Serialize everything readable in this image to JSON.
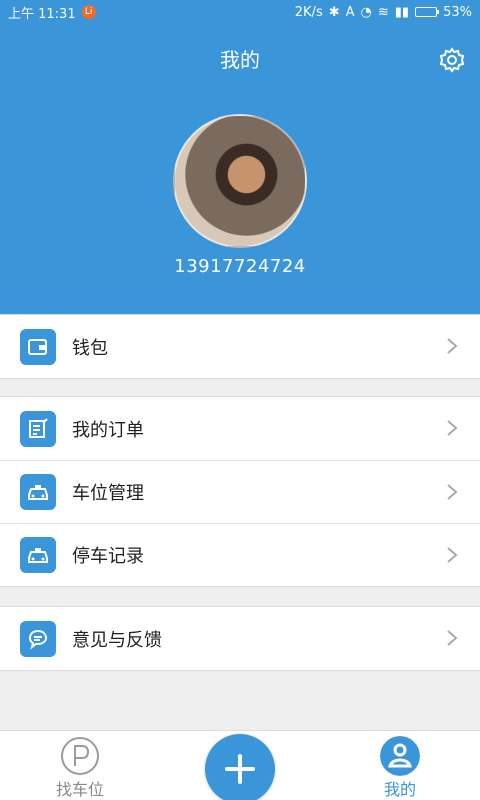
{
  "status_bar": {
    "time": "上午 11:31",
    "notification_badge": "Li",
    "net_speed": "2K/s",
    "battery_text": "53%",
    "battery_level": 0.53
  },
  "header": {
    "title": "我的",
    "phone": "13917724724"
  },
  "menu": {
    "wallet": "钱包",
    "orders": "我的订单",
    "parking_manage": "车位管理",
    "parking_records": "停车记录",
    "feedback": "意见与反馈"
  },
  "bottom_nav": {
    "find_parking": "找车位",
    "mine": "我的"
  },
  "colors": {
    "primary": "#3a95d9",
    "inactive_tab": "#888888",
    "active_tab": "#3a95d9"
  }
}
